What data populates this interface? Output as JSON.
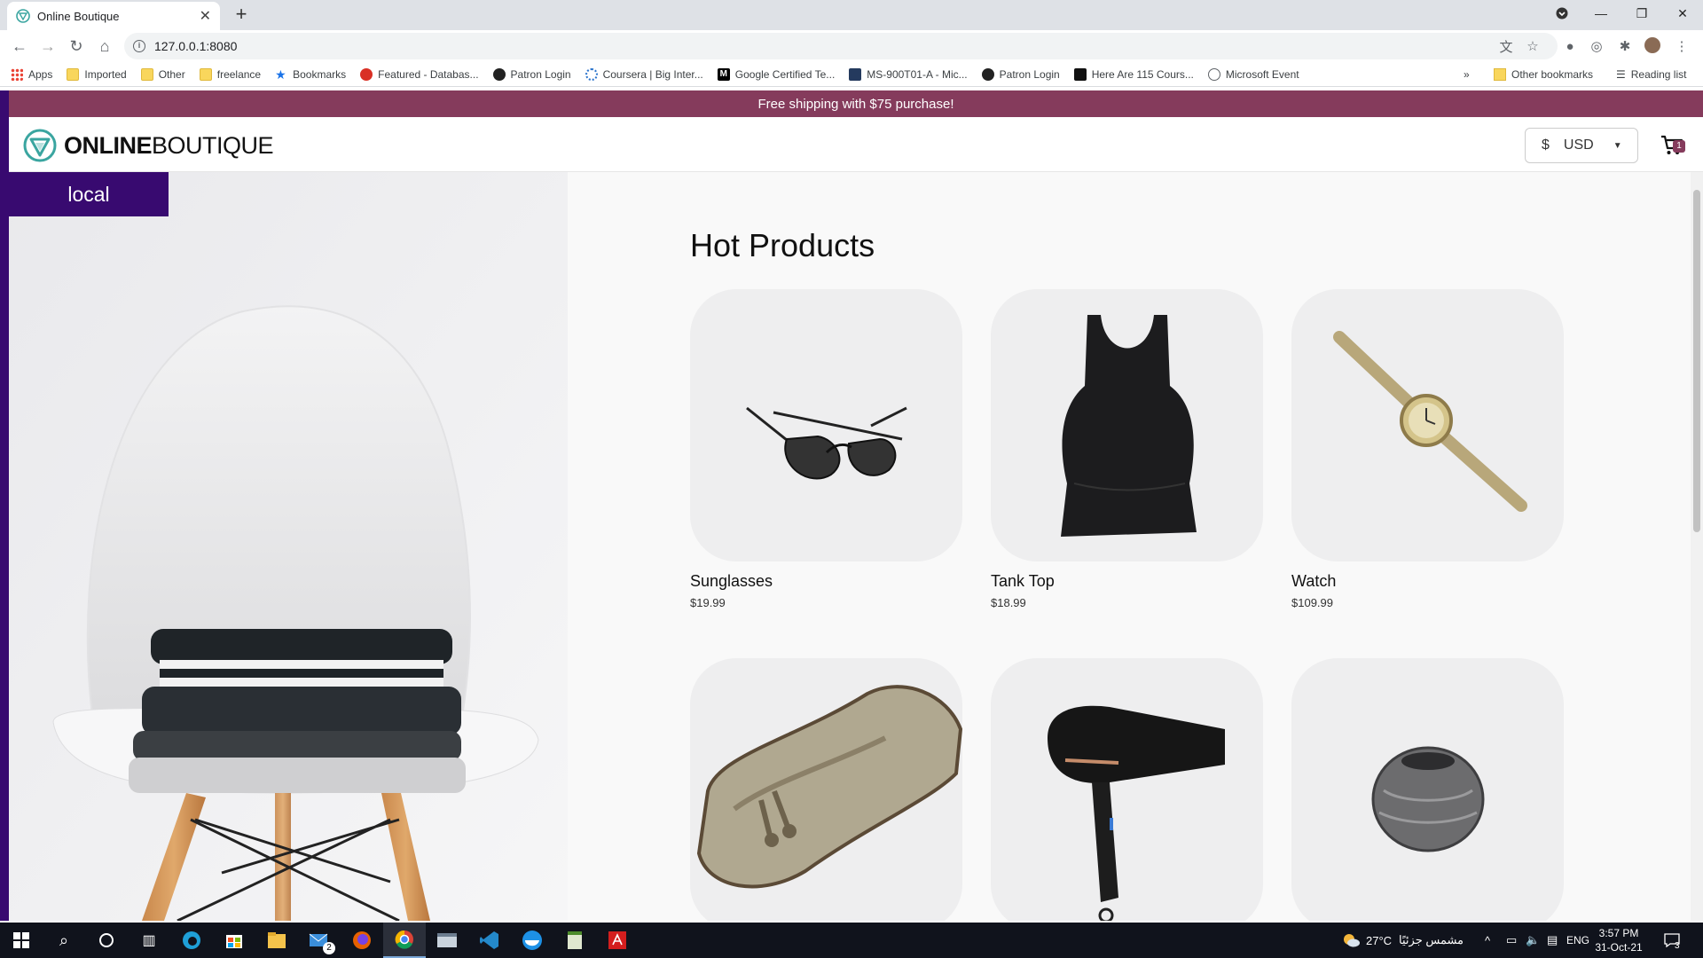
{
  "browser": {
    "tab_title": "Online Boutique",
    "url": "127.0.0.1:8080"
  },
  "bookmarks": [
    {
      "label": "Apps",
      "icon": "apps-icon"
    },
    {
      "label": "Imported",
      "icon": "folder-icon"
    },
    {
      "label": "Other",
      "icon": "folder-icon"
    },
    {
      "label": "freelance",
      "icon": "folder-icon"
    },
    {
      "label": "Bookmarks",
      "icon": "star-icon"
    },
    {
      "label": "Featured - Databas...",
      "icon": "site-icon"
    },
    {
      "label": "Patron Login",
      "icon": "site-icon"
    },
    {
      "label": "Coursera | Big Inter...",
      "icon": "site-icon"
    },
    {
      "label": "Google Certified Te...",
      "icon": "site-icon"
    },
    {
      "label": "MS-900T01-A - Mic...",
      "icon": "site-icon"
    },
    {
      "label": "Patron Login",
      "icon": "site-icon"
    },
    {
      "label": "Here Are 115 Cours...",
      "icon": "site-icon"
    },
    {
      "label": "Microsoft Event",
      "icon": "site-icon"
    }
  ],
  "bookmarks_overflow": "»",
  "other_bookmarks": "Other bookmarks",
  "reading_list": "Reading list",
  "shop": {
    "promo": "Free shipping with $75 purchase!",
    "logo_bold": "ONLINE",
    "logo_light": "BOUTIQUE",
    "currency_symbol": "$",
    "currency": "USD",
    "cart_count": "1",
    "env_label": "local",
    "section_title": "Hot Products",
    "accent": "#853b5c",
    "env_color": "#380a70",
    "products": [
      {
        "name": "Sunglasses",
        "price": "$19.99"
      },
      {
        "name": "Tank Top",
        "price": "$18.99"
      },
      {
        "name": "Watch",
        "price": "$109.99"
      },
      {
        "name": "",
        "price": ""
      },
      {
        "name": "",
        "price": ""
      },
      {
        "name": "",
        "price": ""
      }
    ]
  },
  "taskbar": {
    "weather": "27°C",
    "weather_text": "مشمس جزئيًا",
    "language": "ENG",
    "time": "3:57 PM",
    "date": "31-Oct-21",
    "notifications": "3",
    "mail_badge": "2"
  }
}
